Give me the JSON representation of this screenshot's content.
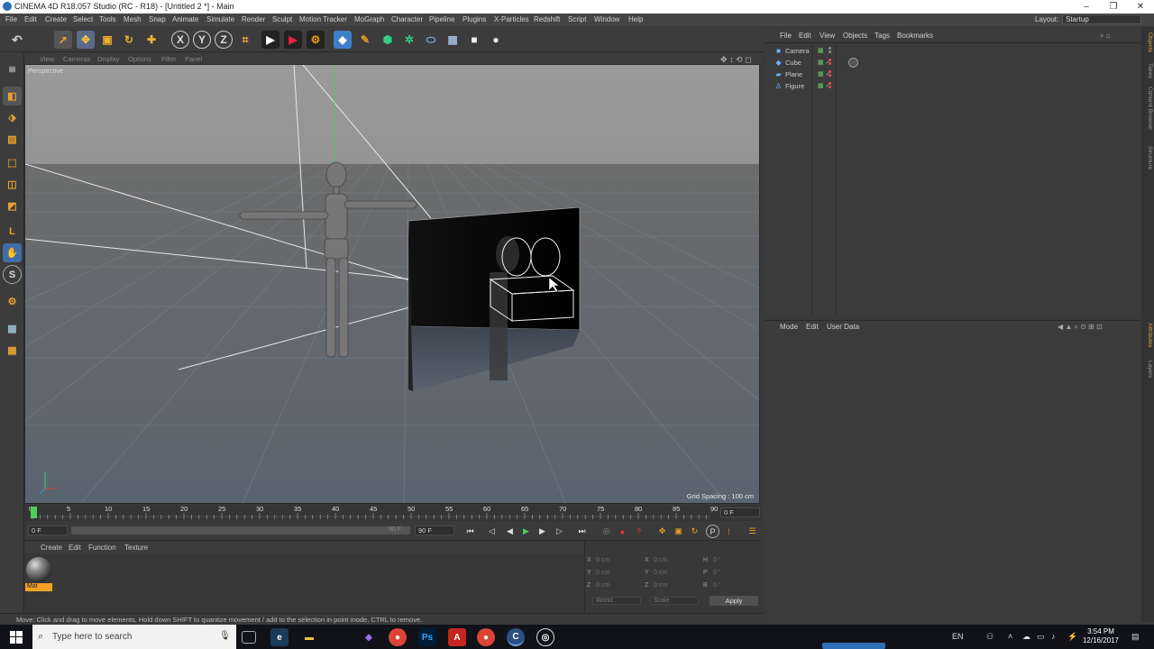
{
  "window": {
    "title": "CINEMA 4D R18.057 Studio (RC - R18) - [Untitled 2 *] - Main"
  },
  "menubar": {
    "items": [
      "File",
      "Edit",
      "Create",
      "Select",
      "Tools",
      "Mesh",
      "Snap",
      "Animate",
      "Simulate",
      "Render",
      "Sculpt",
      "Motion Tracker",
      "MoGraph",
      "Character",
      "Pipeline",
      "Plugins",
      "X-Particles",
      "Redshift",
      "Script",
      "Window",
      "Help"
    ],
    "layout_label": "Layout:",
    "layout_value": "Startup"
  },
  "viewport": {
    "menu": [
      "View",
      "Cameras",
      "Display",
      "Options",
      "Filter",
      "Panel"
    ],
    "label": "Perspective",
    "grid_spacing": "Grid Spacing : 100 cm"
  },
  "timeline": {
    "ticks": [
      "0",
      "5",
      "10",
      "15",
      "20",
      "25",
      "30",
      "35",
      "40",
      "45",
      "50",
      "55",
      "60",
      "65",
      "70",
      "75",
      "80",
      "85",
      "90"
    ],
    "current_frame": "0 F",
    "start_frame": "0 F",
    "end_frame": "90 F",
    "range_end": "90 F"
  },
  "material_manager": {
    "menu": [
      "Create",
      "Edit",
      "Function",
      "Texture"
    ],
    "material_name": "Mat"
  },
  "coordinates": {
    "rows": [
      {
        "a": "X",
        "av": "0 cm",
        "b": "X",
        "bv": "0 cm",
        "c": "H",
        "cv": "0 °"
      },
      {
        "a": "Y",
        "av": "0 cm",
        "b": "Y",
        "bv": "0 cm",
        "c": "P",
        "cv": "0 °"
      },
      {
        "a": "Z",
        "av": "0 cm",
        "b": "Z",
        "bv": "0 cm",
        "c": "B",
        "cv": "0 °"
      }
    ],
    "mode1": "World",
    "mode2": "Scale",
    "apply_label": "Apply"
  },
  "object_manager": {
    "menu": [
      "File",
      "Edit",
      "View",
      "Objects",
      "Tags",
      "Bookmarks"
    ],
    "objects": [
      {
        "name": "Camera",
        "icon": "camera-icon"
      },
      {
        "name": "Cube",
        "icon": "cube-icon"
      },
      {
        "name": "Plane",
        "icon": "plane-icon"
      },
      {
        "name": "Figure",
        "icon": "figure-icon"
      }
    ]
  },
  "attribute_manager": {
    "menu": [
      "Mode",
      "Edit",
      "User Data"
    ]
  },
  "right_tabs": [
    "Objects",
    "Takes",
    "Content Browser",
    "Structure",
    "Attributes",
    "Layers"
  ],
  "status": "Move: Click and drag to move elements. Hold down SHIFT to quantize movement / add to the selection in point mode, CTRL to remove.",
  "taskbar": {
    "search_placeholder": "Type here to search",
    "language": "EN",
    "time": "3:54 PM",
    "date": "12/16/2017"
  }
}
